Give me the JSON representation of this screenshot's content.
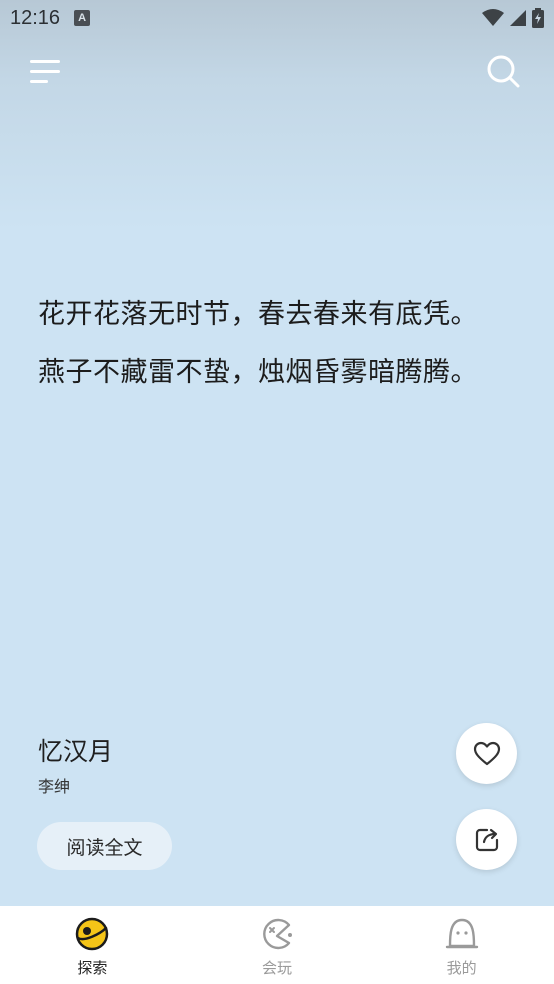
{
  "status_bar": {
    "time": "12:16",
    "notification_letter": "A"
  },
  "poem": {
    "lines": [
      "花开花落无时节，春去春来有底凭。",
      "燕子不藏雷不蛰，烛烟昏雾暗腾腾。"
    ],
    "title": "忆汉月",
    "author": "李绅"
  },
  "actions": {
    "read_full": "阅读全文"
  },
  "bottom_nav": {
    "items": [
      {
        "label": "探索",
        "icon": "planet-icon",
        "active": true
      },
      {
        "label": "会玩",
        "icon": "pacman-icon",
        "active": false
      },
      {
        "label": "我的",
        "icon": "profile-face-icon",
        "active": false
      }
    ]
  },
  "colors": {
    "background": "#cde3f3",
    "accent": "#f5c518",
    "nav_bg": "#ffffff"
  }
}
